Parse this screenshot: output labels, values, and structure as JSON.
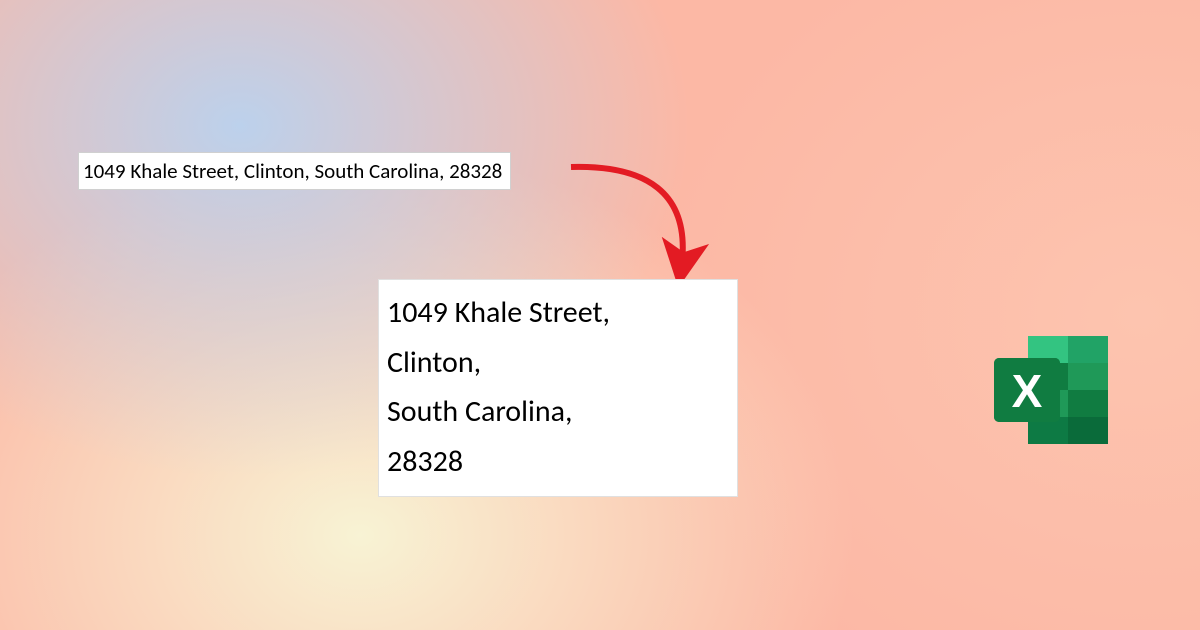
{
  "source_cell": {
    "text": "1049 Khale Street, Clinton, South Carolina, 28328"
  },
  "target_cell": {
    "line1": "1049 Khale Street,",
    "line2": "Clinton,",
    "line3": "South Carolina,",
    "line4": "28328"
  },
  "icons": {
    "excel_letter": "X"
  },
  "colors": {
    "arrow": "#e31b23",
    "excel_dark": "#0d7a44",
    "excel_mid": "#1f9958",
    "excel_light": "#33c481",
    "excel_book": "#21a366"
  }
}
